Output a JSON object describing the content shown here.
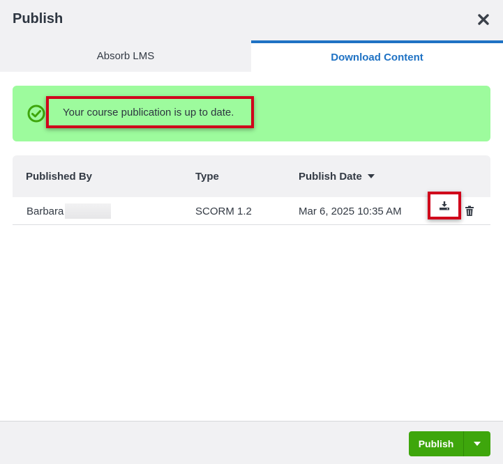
{
  "dialog": {
    "title": "Publish",
    "close_icon": "close-icon"
  },
  "tabs": [
    {
      "label": "Absorb LMS",
      "active": false
    },
    {
      "label": "Download Content",
      "active": true
    }
  ],
  "alert": {
    "icon": "check-circle-icon",
    "message": "Your course publication is up to date.",
    "color": "#9dfb9d"
  },
  "table": {
    "columns": {
      "published_by": "Published By",
      "type": "Type",
      "publish_date": "Publish Date"
    },
    "sort_indicator": "caret-down-icon",
    "rows": [
      {
        "published_by": "Barbara",
        "type": "SCORM 1.2",
        "publish_date": "Mar 6, 2025 10:35 AM",
        "actions": [
          "download-icon",
          "trash-icon"
        ]
      }
    ]
  },
  "footer": {
    "publish_label": "Publish",
    "accent": "#3ea60c"
  },
  "colors": {
    "tab_active": "#1f72c4",
    "highlight": "#d0021b"
  }
}
